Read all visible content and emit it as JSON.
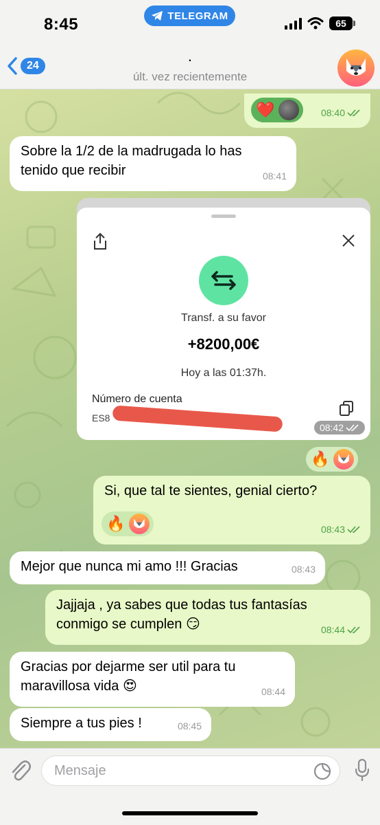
{
  "status_bar": {
    "time": "8:45",
    "app_pill": "TELEGRAM",
    "battery": "65"
  },
  "header": {
    "back_count": "24",
    "contact_name": ".",
    "contact_status": "últ. vez recientemente"
  },
  "messages": [
    {
      "id": "m1",
      "direction": "out",
      "reactions": [
        "❤️",
        "photo-avatar"
      ],
      "time": "08:40",
      "read": true
    },
    {
      "id": "m2",
      "direction": "in",
      "text_line1": "Sobre la 1/2 de la madrugada lo has",
      "text_line2": "tenido que recibir",
      "time": "08:41"
    },
    {
      "id": "m3",
      "direction": "out",
      "type": "image",
      "time": "08:42",
      "read": true,
      "card": {
        "label": "Transf. a su favor",
        "amount": "+8200,00€",
        "date": "Hoy a las 01:37h.",
        "account_label": "Número de cuenta",
        "account_prefix": "ES8"
      }
    },
    {
      "id": "m4",
      "direction": "out",
      "reactions": [
        "🔥",
        "avatar"
      ]
    },
    {
      "id": "m5",
      "direction": "out",
      "text": "Si, que tal te sientes, genial cierto?",
      "reactions": [
        "🔥",
        "avatar"
      ],
      "time": "08:43",
      "read": true
    },
    {
      "id": "m6",
      "direction": "in",
      "text": "Mejor que nunca mi amo !!! Gracias",
      "time": "08:43"
    },
    {
      "id": "m7",
      "direction": "out",
      "text_line1": "Jajjaja , ya sabes que todas tus fantasías",
      "text_line2": "conmigo se cumplen 😏",
      "time": "08:44",
      "read": true
    },
    {
      "id": "m8",
      "direction": "in",
      "text_line1": "Gracias por dejarme ser util para tu",
      "text_line2": "maravillosa vida 😍",
      "time": "08:44"
    },
    {
      "id": "m9",
      "direction": "in",
      "text": "Siempre a tus pies !",
      "time": "08:45"
    }
  ],
  "input": {
    "placeholder": "Mensaje"
  },
  "icons": {
    "back": "chevron-left-icon",
    "attach": "paperclip-icon",
    "sticker": "sticker-icon",
    "mic": "microphone-icon",
    "share": "share-icon",
    "close": "close-icon",
    "transfer": "transfer-arrows-icon",
    "copy": "copy-icon"
  },
  "colors": {
    "accent": "#2f86e6",
    "outgoing_bubble": "#e8f8c8",
    "incoming_bubble": "#ffffff",
    "read_check": "#4fa34a",
    "transfer_green": "#5fe3a3",
    "redaction": "#e8584a"
  }
}
